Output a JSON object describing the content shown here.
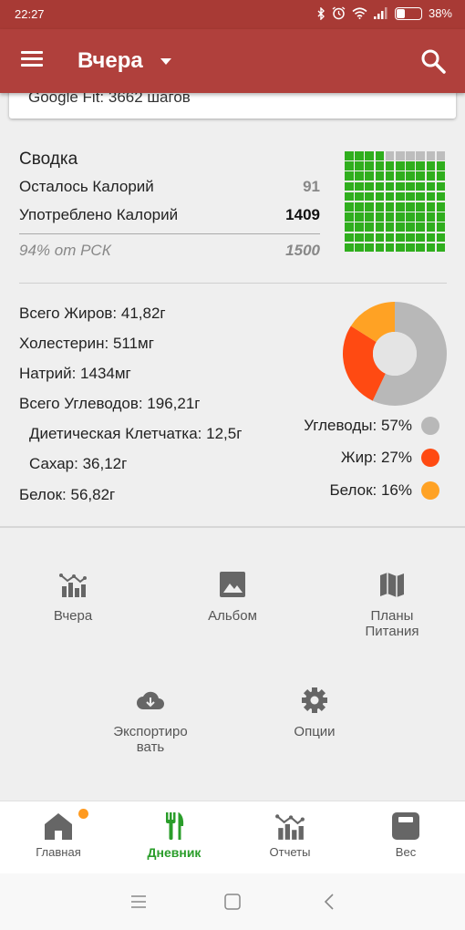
{
  "status_bar": {
    "time": "22:27",
    "battery_percent": "38%",
    "battery_level": 0.38,
    "icons": [
      "bluetooth-icon",
      "alarm-icon",
      "wifi-icon",
      "signal-icon",
      "battery-icon"
    ]
  },
  "app_bar": {
    "title": "Вчера",
    "icons": [
      "menu-icon",
      "dropdown-caret-icon",
      "search-icon"
    ]
  },
  "google_fit": {
    "text": "Google Fit: 3662 шагов"
  },
  "summary": {
    "title": "Сводка",
    "remaining_label": "Осталось Калорий",
    "remaining_value": "91",
    "consumed_label": "Употреблено Калорий",
    "consumed_value": "1409",
    "percent_label": "94% от РСК",
    "target_value": "1500",
    "waffle_filled": 94,
    "waffle_total": 100,
    "colors": {
      "filled": "#2fae1d",
      "empty": "#bdbdbd"
    }
  },
  "nutrients": {
    "fat": "Всего Жиров: 41,82г",
    "cholesterol": "Холестерин: 511мг",
    "sodium": "Натрий: 1434мг",
    "carbs": "Всего Углеводов: 196,21г",
    "fiber": "Диетическая Клетчатка: 12,5г",
    "sugar": "Сахар: 36,12г",
    "protein": "Белок: 56,82г"
  },
  "macro_chart": {
    "slices": [
      {
        "label": "Углеводы: 57%",
        "value": 57,
        "color": "#b8b8b8"
      },
      {
        "label": "Жир: 27%",
        "value": 27,
        "color": "#ff4a12"
      },
      {
        "label": "Белок: 16%",
        "value": 16,
        "color": "#ffa224"
      }
    ]
  },
  "shortcuts": {
    "yesterday": "Вчера",
    "album": "Альбом",
    "meal_plans_line1": "Планы",
    "meal_plans_line2": "Питания",
    "export_line1": "Экспортиро",
    "export_line2": "вать",
    "options": "Опции"
  },
  "bottom_nav": {
    "home": "Главная",
    "diary": "Дневник",
    "reports": "Отчеты",
    "weight": "Вес",
    "colors": {
      "active": "#2a9d2a",
      "badge": "#ff9a1f"
    }
  }
}
